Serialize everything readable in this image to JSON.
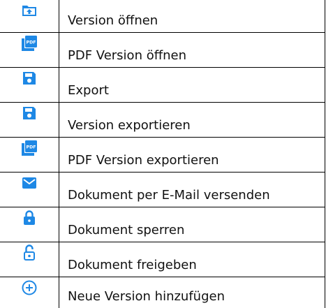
{
  "accent_color": "#1e88e5",
  "rows": [
    {
      "icon": "folder-upload-icon",
      "label": "Version öffnen"
    },
    {
      "icon": "pdf-file-icon",
      "label": "PDF Version öffnen"
    },
    {
      "icon": "floppy-disk-icon",
      "label": "Export"
    },
    {
      "icon": "floppy-disk-icon",
      "label": "Version exportieren"
    },
    {
      "icon": "pdf-file-icon",
      "label": "PDF Version exportieren"
    },
    {
      "icon": "envelope-icon",
      "label": "Dokument per E-Mail versenden"
    },
    {
      "icon": "lock-closed-icon",
      "label": "Dokument sperren"
    },
    {
      "icon": "lock-open-icon",
      "label": "Dokument freigeben"
    },
    {
      "icon": "add-circle-icon",
      "label": "Neue Version hinzufügen"
    }
  ]
}
